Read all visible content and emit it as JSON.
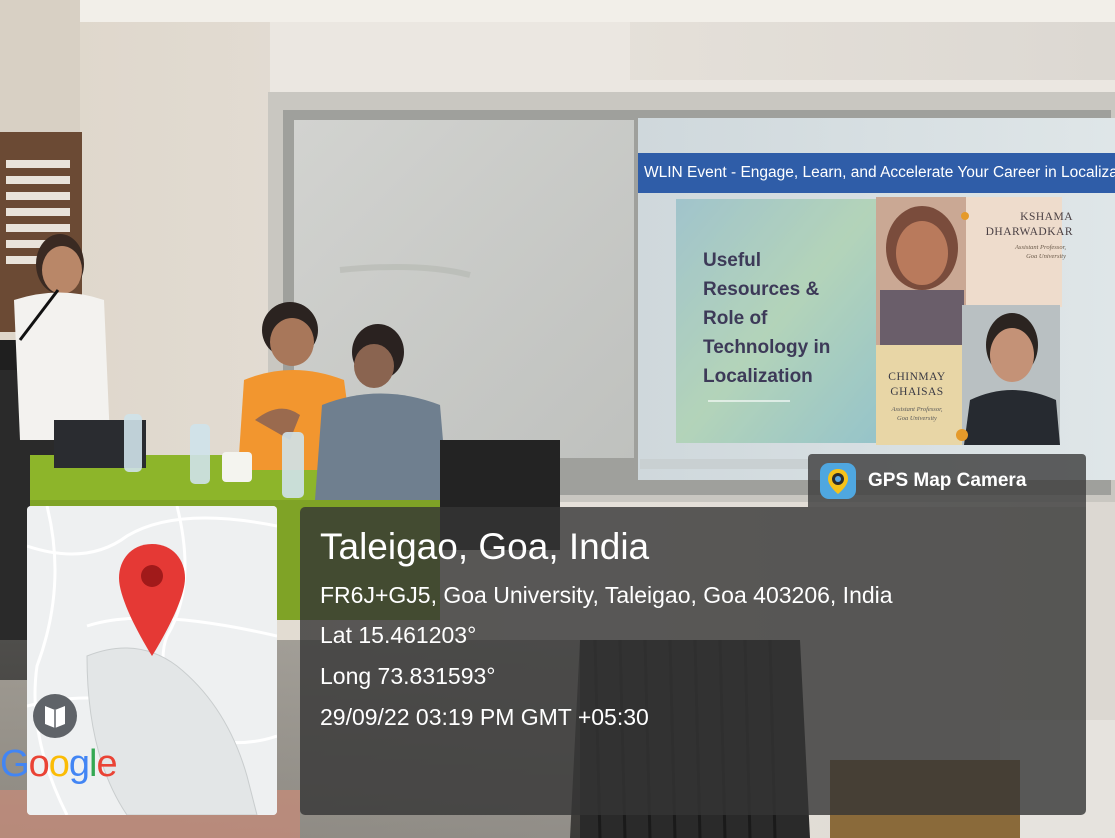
{
  "slide": {
    "header": "WLIN Event - Engage, Learn, and Accelerate Your Career in Localizatio",
    "title_lines": [
      "Useful",
      "Resources &",
      "Role of",
      "Technology in",
      "Localization"
    ],
    "speaker1": {
      "name_lines": [
        "KSHAMA",
        "DHARWADKAR"
      ],
      "role_lines": [
        "Assistant Professor,",
        "Goa University"
      ]
    },
    "speaker2": {
      "name_lines": [
        "CHINMAY",
        "GHAISAS"
      ],
      "role_lines": [
        "Assistant Professor,",
        "Goa University"
      ]
    }
  },
  "gps_overlay": {
    "app_name": "GPS Map Camera",
    "place": "Taleigao, Goa, India",
    "address": "FR6J+GJ5, Goa University, Taleigao, Goa 403206, India",
    "latitude": "Lat 15.461203°",
    "longitude": "Long 73.831593°",
    "timestamp": "29/09/22 03:19 PM GMT +05:30"
  },
  "map": {
    "logo_letters": [
      "G",
      "o",
      "o",
      "g",
      "l",
      "e"
    ],
    "logo_colors": [
      "#4285F4",
      "#EA4335",
      "#FBBC05",
      "#4285F4",
      "#34A853",
      "#EA4335"
    ],
    "pin_color": "#E53935",
    "pin_inner_color": "#A11A1A",
    "book_marker_color": "#5F6368"
  },
  "colors": {
    "overlay_background": "#343434",
    "slide_header_bar": "#2F5DA8",
    "tablecloth": "#8DB52A"
  }
}
